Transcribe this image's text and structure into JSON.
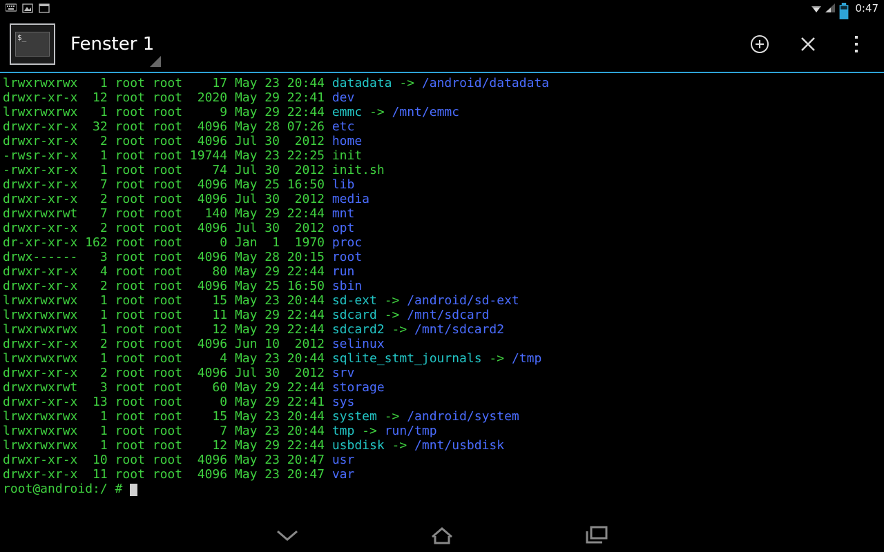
{
  "status": {
    "clock": "0:47"
  },
  "window": {
    "label": "Fenster 1"
  },
  "listing": [
    {
      "perm": "lrwxrwxrwx",
      "links": "1",
      "owner": "root",
      "group": "root",
      "size": "17",
      "date": "May 23 20:44",
      "name": "datadata -> /android/datadata",
      "type": "link"
    },
    {
      "perm": "drwxr-xr-x",
      "links": "12",
      "owner": "root",
      "group": "root",
      "size": "2020",
      "date": "May 29 22:41",
      "name": "dev",
      "type": "dir"
    },
    {
      "perm": "lrwxrwxrwx",
      "links": "1",
      "owner": "root",
      "group": "root",
      "size": "9",
      "date": "May 29 22:44",
      "name": "emmc -> /mnt/emmc",
      "type": "link"
    },
    {
      "perm": "drwxr-xr-x",
      "links": "32",
      "owner": "root",
      "group": "root",
      "size": "4096",
      "date": "May 28 07:26",
      "name": "etc",
      "type": "dir"
    },
    {
      "perm": "drwxr-xr-x",
      "links": "2",
      "owner": "root",
      "group": "root",
      "size": "4096",
      "date": "Jul 30  2012",
      "name": "home",
      "type": "dir"
    },
    {
      "perm": "-rwsr-xr-x",
      "links": "1",
      "owner": "root",
      "group": "root",
      "size": "19744",
      "date": "May 23 22:25",
      "name": "init",
      "type": "file"
    },
    {
      "perm": "-rwxr-xr-x",
      "links": "1",
      "owner": "root",
      "group": "root",
      "size": "74",
      "date": "Jul 30  2012",
      "name": "init.sh",
      "type": "file"
    },
    {
      "perm": "drwxr-xr-x",
      "links": "7",
      "owner": "root",
      "group": "root",
      "size": "4096",
      "date": "May 25 16:50",
      "name": "lib",
      "type": "dir"
    },
    {
      "perm": "drwxr-xr-x",
      "links": "2",
      "owner": "root",
      "group": "root",
      "size": "4096",
      "date": "Jul 30  2012",
      "name": "media",
      "type": "dir"
    },
    {
      "perm": "drwxrwxrwt",
      "links": "7",
      "owner": "root",
      "group": "root",
      "size": "140",
      "date": "May 29 22:44",
      "name": "mnt",
      "type": "dir"
    },
    {
      "perm": "drwxr-xr-x",
      "links": "2",
      "owner": "root",
      "group": "root",
      "size": "4096",
      "date": "Jul 30  2012",
      "name": "opt",
      "type": "dir"
    },
    {
      "perm": "dr-xr-xr-x",
      "links": "162",
      "owner": "root",
      "group": "root",
      "size": "0",
      "date": "Jan  1  1970",
      "name": "proc",
      "type": "dir"
    },
    {
      "perm": "drwx------",
      "links": "3",
      "owner": "root",
      "group": "root",
      "size": "4096",
      "date": "May 28 20:15",
      "name": "root",
      "type": "dir"
    },
    {
      "perm": "drwxr-xr-x",
      "links": "4",
      "owner": "root",
      "group": "root",
      "size": "80",
      "date": "May 29 22:44",
      "name": "run",
      "type": "dir"
    },
    {
      "perm": "drwxr-xr-x",
      "links": "2",
      "owner": "root",
      "group": "root",
      "size": "4096",
      "date": "May 25 16:50",
      "name": "sbin",
      "type": "dir"
    },
    {
      "perm": "lrwxrwxrwx",
      "links": "1",
      "owner": "root",
      "group": "root",
      "size": "15",
      "date": "May 23 20:44",
      "name": "sd-ext -> /android/sd-ext",
      "type": "link"
    },
    {
      "perm": "lrwxrwxrwx",
      "links": "1",
      "owner": "root",
      "group": "root",
      "size": "11",
      "date": "May 29 22:44",
      "name": "sdcard -> /mnt/sdcard",
      "type": "link"
    },
    {
      "perm": "lrwxrwxrwx",
      "links": "1",
      "owner": "root",
      "group": "root",
      "size": "12",
      "date": "May 29 22:44",
      "name": "sdcard2 -> /mnt/sdcard2",
      "type": "link"
    },
    {
      "perm": "drwxr-xr-x",
      "links": "2",
      "owner": "root",
      "group": "root",
      "size": "4096",
      "date": "Jun 10  2012",
      "name": "selinux",
      "type": "dir"
    },
    {
      "perm": "lrwxrwxrwx",
      "links": "1",
      "owner": "root",
      "group": "root",
      "size": "4",
      "date": "May 23 20:44",
      "name": "sqlite_stmt_journals -> /tmp",
      "type": "link"
    },
    {
      "perm": "drwxr-xr-x",
      "links": "2",
      "owner": "root",
      "group": "root",
      "size": "4096",
      "date": "Jul 30  2012",
      "name": "srv",
      "type": "dir"
    },
    {
      "perm": "drwxrwxrwt",
      "links": "3",
      "owner": "root",
      "group": "root",
      "size": "60",
      "date": "May 29 22:44",
      "name": "storage",
      "type": "dir"
    },
    {
      "perm": "drwxr-xr-x",
      "links": "13",
      "owner": "root",
      "group": "root",
      "size": "0",
      "date": "May 29 22:41",
      "name": "sys",
      "type": "dir"
    },
    {
      "perm": "lrwxrwxrwx",
      "links": "1",
      "owner": "root",
      "group": "root",
      "size": "15",
      "date": "May 23 20:44",
      "name": "system -> /android/system",
      "type": "link"
    },
    {
      "perm": "lrwxrwxrwx",
      "links": "1",
      "owner": "root",
      "group": "root",
      "size": "7",
      "date": "May 23 20:44",
      "name": "tmp -> run/tmp",
      "type": "link"
    },
    {
      "perm": "lrwxrwxrwx",
      "links": "1",
      "owner": "root",
      "group": "root",
      "size": "12",
      "date": "May 29 22:44",
      "name": "usbdisk -> /mnt/usbdisk",
      "type": "link"
    },
    {
      "perm": "drwxr-xr-x",
      "links": "10",
      "owner": "root",
      "group": "root",
      "size": "4096",
      "date": "May 23 20:47",
      "name": "usr",
      "type": "dir"
    },
    {
      "perm": "drwxr-xr-x",
      "links": "11",
      "owner": "root",
      "group": "root",
      "size": "4096",
      "date": "May 23 20:47",
      "name": "var",
      "type": "dir"
    }
  ],
  "prompt": "root@android:/ # "
}
